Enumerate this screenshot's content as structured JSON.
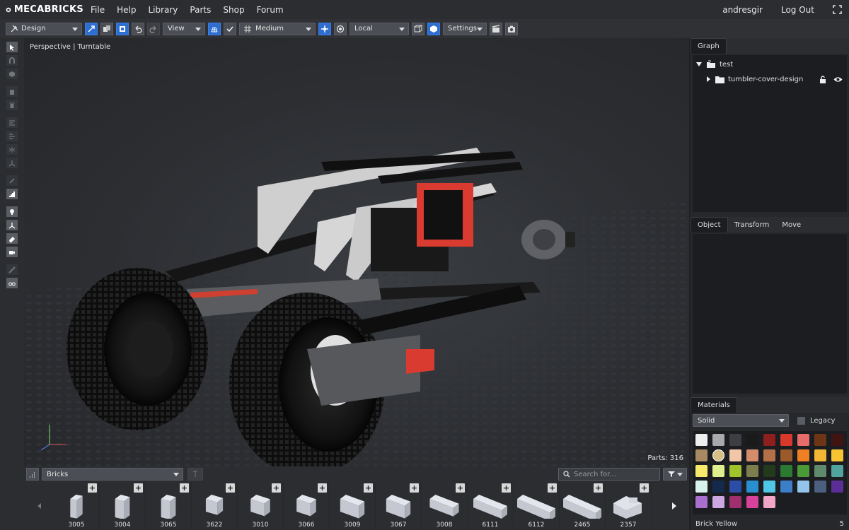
{
  "app": {
    "name": "MECABRICKS"
  },
  "menu": [
    "File",
    "Help",
    "Library",
    "Parts",
    "Shop",
    "Forum"
  ],
  "user": {
    "name": "andresgir",
    "logout": "Log Out"
  },
  "toolbar": {
    "mode": "Design",
    "view": "View",
    "quality": "Medium",
    "space": "Local",
    "settings": "Settings"
  },
  "viewport": {
    "label": "Perspective | Turntable",
    "parts": "Parts: 316"
  },
  "graph": {
    "tab": "Graph",
    "root": "test",
    "child": "tumbler-cover-design"
  },
  "object_tabs": [
    "Object",
    "Transform",
    "Move"
  ],
  "materials": {
    "tab": "Materials",
    "type": "Solid",
    "legacy_label": "Legacy",
    "selected_name": "Brick Yellow",
    "selected_id": "5",
    "swatches": [
      "#eeeeee",
      "#a7a9ab",
      "#3c3e42",
      "#1a1a1a",
      "#8e1f1f",
      "#d8392c",
      "#e86c6c",
      "#6e3517",
      "#3f1411",
      "#a78a62",
      "#d5bf87",
      "#f2c6a8",
      "#d58c6d",
      "#b27047",
      "#9a5a2a",
      "#ee7f22",
      "#f1b633",
      "#f6c531",
      "#f6ea6b",
      "#dff08e",
      "#9fc42b",
      "#7d7e4e",
      "#233a1c",
      "#2c7a31",
      "#4a9a37",
      "#5f8a6d",
      "#51a39d",
      "#d7f1ec",
      "#142a4c",
      "#2a4ea7",
      "#2a8fce",
      "#4fc7e6",
      "#3d7ec8",
      "#94c4ea",
      "#4b607e",
      "#5a2e96",
      "#a86fcd",
      "#cda7e1",
      "#9f2f6d",
      "#d9429a",
      "#f2a6c7"
    ]
  },
  "bricks_bar": {
    "category": "Bricks",
    "search_placeholder": "Search for..."
  },
  "bricks": [
    {
      "code": "3005",
      "len": 1
    },
    {
      "code": "3004",
      "len": 2
    },
    {
      "code": "3065",
      "len": 2
    },
    {
      "code": "3622",
      "len": 3
    },
    {
      "code": "3010",
      "len": 4
    },
    {
      "code": "3066",
      "len": 4
    },
    {
      "code": "3009",
      "len": 6
    },
    {
      "code": "3067",
      "len": 6
    },
    {
      "code": "3008",
      "len": 8
    },
    {
      "code": "6111",
      "len": 10
    },
    {
      "code": "6112",
      "len": 12
    },
    {
      "code": "2465",
      "len": 16
    },
    {
      "code": "2357",
      "len": 0
    }
  ]
}
